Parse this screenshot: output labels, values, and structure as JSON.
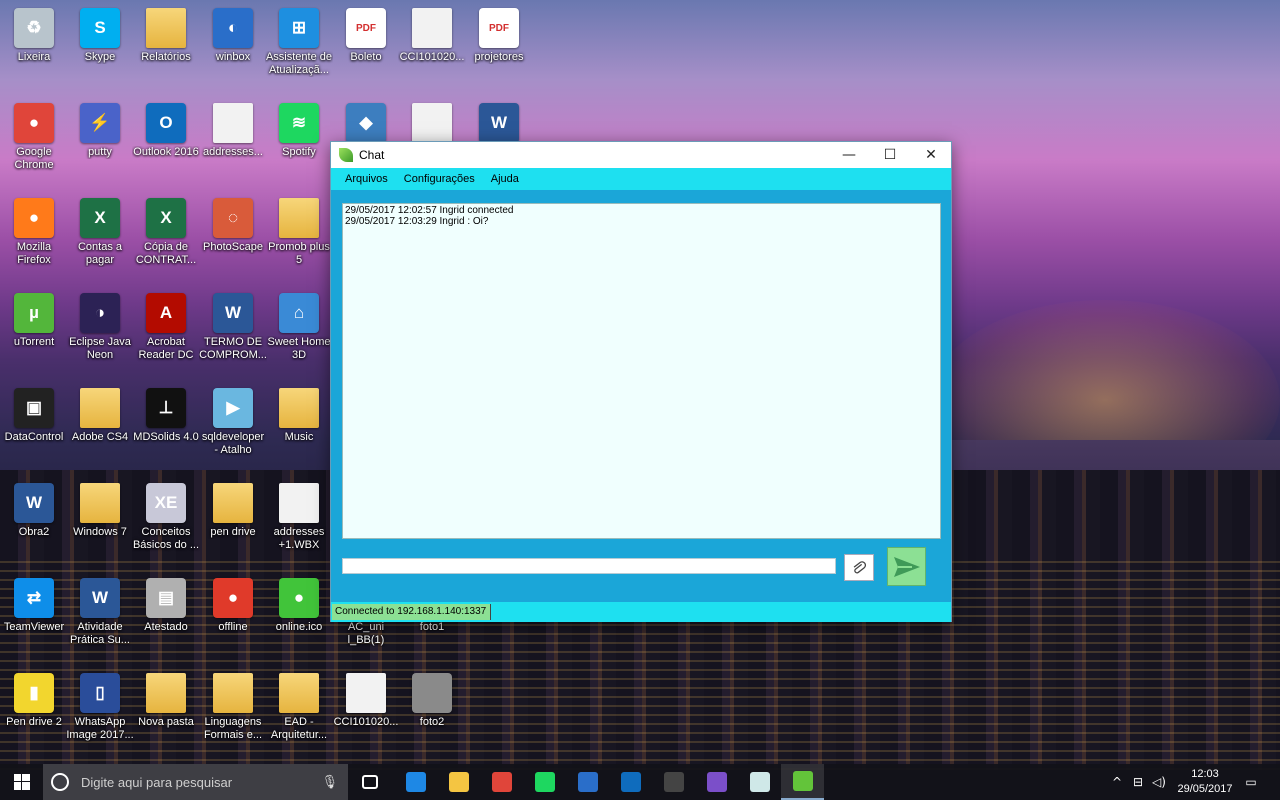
{
  "desktop_icons": [
    {
      "label": "Lixeira",
      "kind": "recycle",
      "glyph": "♻",
      "color": "#b8c4cc"
    },
    {
      "label": "Skype",
      "kind": "app",
      "glyph": "S",
      "color": "#00aff0"
    },
    {
      "label": "Relatórios",
      "kind": "folder",
      "glyph": "",
      "color": "#e6b43f"
    },
    {
      "label": "winbox",
      "kind": "app",
      "glyph": "◐",
      "color": "#2a6ec9"
    },
    {
      "label": "Assistente de Atualizaçã...",
      "kind": "app",
      "glyph": "⊞",
      "color": "#1e8fe0"
    },
    {
      "label": "Boleto",
      "kind": "pdf",
      "glyph": "PDF",
      "color": "#d32f2f"
    },
    {
      "label": "CCI101020...",
      "kind": "doc",
      "glyph": "",
      "color": "#eeeeee"
    },
    {
      "label": "projetores",
      "kind": "pdf",
      "glyph": "PDF",
      "color": "#d32f2f"
    },
    {
      "label": "Google Chrome",
      "kind": "app",
      "glyph": "●",
      "color": "#e0453a"
    },
    {
      "label": "putty",
      "kind": "app",
      "glyph": "⚡",
      "color": "#4a63c9"
    },
    {
      "label": "Outlook 2016",
      "kind": "app",
      "glyph": "O",
      "color": "#0f6cbd"
    },
    {
      "label": "addresses...",
      "kind": "doc",
      "glyph": "",
      "color": "#ffffff"
    },
    {
      "label": "Spotify",
      "kind": "app",
      "glyph": "≋",
      "color": "#1ed760"
    },
    {
      "label": "",
      "kind": "app",
      "glyph": "◆",
      "color": "#3d7ebf"
    },
    {
      "label": "",
      "kind": "doc",
      "glyph": "",
      "color": "#eeeeee"
    },
    {
      "label": "",
      "kind": "app",
      "glyph": "W",
      "color": "#2b5797"
    },
    {
      "label": "Mozilla Firefox",
      "kind": "app",
      "glyph": "●",
      "color": "#ff7a1a"
    },
    {
      "label": "Contas a pagar",
      "kind": "app",
      "glyph": "X",
      "color": "#1e7145"
    },
    {
      "label": "Cópia de CONTRAT...",
      "kind": "app",
      "glyph": "X",
      "color": "#1e7145"
    },
    {
      "label": "PhotoScape",
      "kind": "app",
      "glyph": "◌",
      "color": "#d95b3a"
    },
    {
      "label": "Promob plus 5",
      "kind": "folder",
      "glyph": "",
      "color": "#e6b43f"
    },
    {
      "label": "uTorrent",
      "kind": "app",
      "glyph": "µ",
      "color": "#53b63b"
    },
    {
      "label": "Eclipse Java Neon",
      "kind": "app",
      "glyph": "◑",
      "color": "#2c2255"
    },
    {
      "label": "Acrobat Reader DC",
      "kind": "app",
      "glyph": "A",
      "color": "#b30b00"
    },
    {
      "label": "TERMO DE COMPROM...",
      "kind": "app",
      "glyph": "W",
      "color": "#2b5797"
    },
    {
      "label": "Sweet Home 3D",
      "kind": "app",
      "glyph": "⌂",
      "color": "#3a8ad6"
    },
    {
      "label": "DataControl",
      "kind": "app",
      "glyph": "▣",
      "color": "#222222"
    },
    {
      "label": "Adobe CS4",
      "kind": "folder",
      "glyph": "",
      "color": "#e6b43f"
    },
    {
      "label": "MDSolids 4.0",
      "kind": "app",
      "glyph": "⊥",
      "color": "#111111"
    },
    {
      "label": "sqldeveloper - Atalho",
      "kind": "app",
      "glyph": "▶",
      "color": "#6ab7e0"
    },
    {
      "label": "Music",
      "kind": "folder",
      "glyph": "",
      "color": "#e6b43f"
    },
    {
      "label": "Obra2",
      "kind": "app",
      "glyph": "W",
      "color": "#2b5797"
    },
    {
      "label": "Windows 7",
      "kind": "folder",
      "glyph": "",
      "color": "#e6b43f"
    },
    {
      "label": "Conceitos Básicos do ...",
      "kind": "app",
      "glyph": "XE",
      "color": "#c8c8d8"
    },
    {
      "label": "pen drive",
      "kind": "folder",
      "glyph": "",
      "color": "#e6b43f"
    },
    {
      "label": "addresses +1.WBX",
      "kind": "doc",
      "glyph": "",
      "color": "#ffffff"
    },
    {
      "label": "TeamViewer",
      "kind": "app",
      "glyph": "⇄",
      "color": "#0e8ee9"
    },
    {
      "label": "Atividade Prática Su...",
      "kind": "app",
      "glyph": "W",
      "color": "#2b5797"
    },
    {
      "label": "Atestado",
      "kind": "app",
      "glyph": "▤",
      "color": "#b0b0b0"
    },
    {
      "label": "offline",
      "kind": "app",
      "glyph": "●",
      "color": "#e03a2a"
    },
    {
      "label": "online.ico",
      "kind": "app",
      "glyph": "●",
      "color": "#41c43a"
    },
    {
      "label": "AC_uni l_BB(1)",
      "kind": "app",
      "glyph": "",
      "color": "#555555"
    },
    {
      "label": "foto1",
      "kind": "app",
      "glyph": "",
      "color": "#777777"
    },
    {
      "label": "Pen drive 2",
      "kind": "app",
      "glyph": "▮",
      "color": "#f2d62e"
    },
    {
      "label": "WhatsApp Image 2017...",
      "kind": "app",
      "glyph": "▯",
      "color": "#2a4d9a"
    },
    {
      "label": "Nova pasta",
      "kind": "folder",
      "glyph": "",
      "color": "#e6b43f"
    },
    {
      "label": "Linguagens Formais e...",
      "kind": "folder",
      "glyph": "",
      "color": "#e6b43f"
    },
    {
      "label": "EAD - Arquitetur...",
      "kind": "folder",
      "glyph": "",
      "color": "#e6b43f"
    },
    {
      "label": "CCI101020...",
      "kind": "doc",
      "glyph": "",
      "color": "#eeeeee"
    },
    {
      "label": "foto2",
      "kind": "app",
      "glyph": "",
      "color": "#8a8a8a"
    }
  ],
  "chat_window": {
    "title": "Chat",
    "controls": {
      "minimize": "—",
      "maximize": "☐",
      "close": "✕"
    },
    "menu": [
      "Arquivos",
      "Configurações",
      "Ajuda"
    ],
    "messages": [
      "29/05/2017 12:02:57 Ingrid connected",
      "29/05/2017 12:03:29 Ingrid : Oi?"
    ],
    "message_input": {
      "value": "",
      "placeholder": ""
    },
    "attach_icon": "paperclip-icon",
    "send_icon": "send-icon",
    "status": "Connected to 192.168.1.140:1337"
  },
  "taskbar": {
    "search_placeholder": "Digite aqui para pesquisar",
    "pinned": [
      {
        "name": "task-view",
        "color": "#ffffff"
      },
      {
        "name": "edge",
        "color": "#1e88e5"
      },
      {
        "name": "file-explorer",
        "color": "#f4c542"
      },
      {
        "name": "chrome",
        "color": "#e0453a"
      },
      {
        "name": "spotify",
        "color": "#1ed760"
      },
      {
        "name": "winbox",
        "color": "#2a6ec9"
      },
      {
        "name": "outlook",
        "color": "#0f6cbd"
      },
      {
        "name": "terminal",
        "color": "#444444"
      },
      {
        "name": "visual-studio",
        "color": "#7b4fc9"
      },
      {
        "name": "app-window",
        "color": "#cfe8e8"
      },
      {
        "name": "chat-app",
        "color": "#63c43a"
      }
    ],
    "tray": [
      "^",
      "⊟",
      "◁)",
      "▭"
    ],
    "time": "12:03",
    "date": "29/05/2017"
  },
  "colors": {
    "chat_accent": "#1ee0f0",
    "chat_body": "#1ba6d8",
    "status_bg": "#8ce094"
  }
}
